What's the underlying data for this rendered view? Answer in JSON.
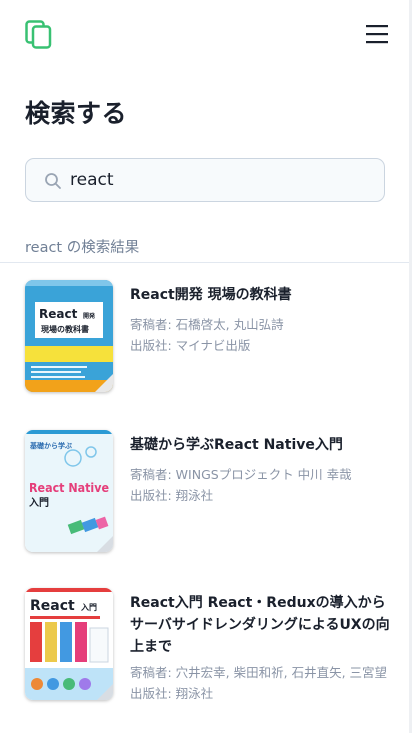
{
  "header": {
    "logo_icon": "copy-pages-logo",
    "menu_icon": "hamburger-menu-icon"
  },
  "page_title": "検索する",
  "search": {
    "value": "react",
    "placeholder": "",
    "icon": "search-icon"
  },
  "results_label": "react の検索結果",
  "books": [
    {
      "title": "React開発 現場の教科書",
      "authors": "寄稿者: 石橋啓太, 丸山弘詩",
      "publisher": "出版社: マイナビ出版",
      "cover_text": [
        "React",
        "開発",
        "現場の教科書"
      ]
    },
    {
      "title": "基礎から学ぶReact Native入門",
      "authors": "寄稿者: WINGSプロジェクト 中川 幸哉",
      "publisher": "出版社: 翔泳社",
      "cover_text": [
        "基礎から学ぶ",
        "React Native",
        "入門"
      ]
    },
    {
      "title": "React入門 React・Reduxの導入からサーバサイドレンダリングによるUXの向上まで",
      "authors": "寄稿者: 穴井宏幸, 柴田和祈, 石井直矢, 三宮望",
      "publisher": "出版社: 翔泳社",
      "cover_text": [
        "React",
        "入門"
      ]
    }
  ],
  "colors": {
    "accent": "#38c172",
    "title": "#1a202c",
    "muted": "#8a94a6"
  }
}
